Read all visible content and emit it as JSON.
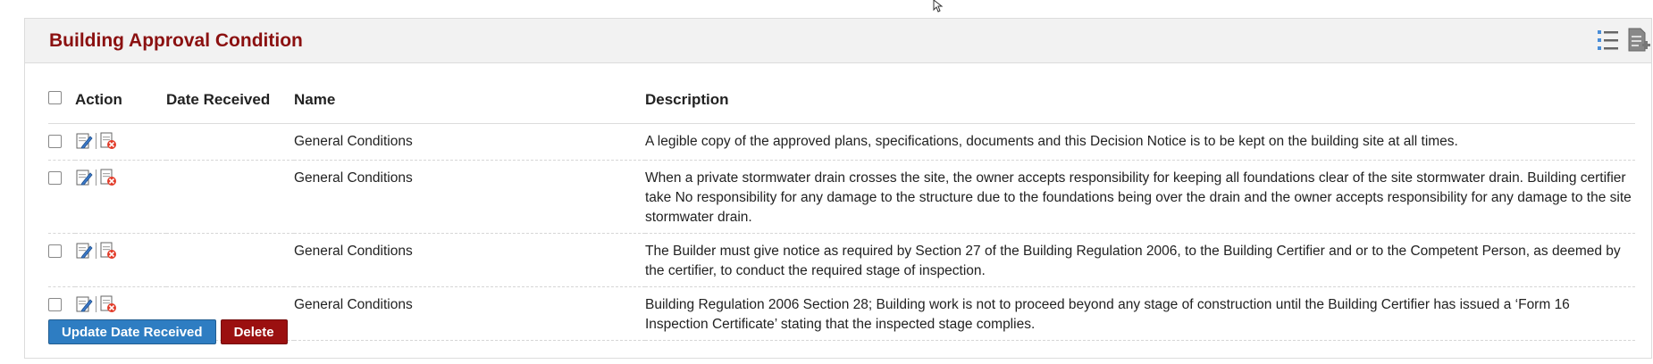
{
  "panel": {
    "title": "Building Approval Condition"
  },
  "table": {
    "headers": {
      "action": "Action",
      "date_received": "Date Received",
      "name": "Name",
      "description": "Description"
    },
    "rows": [
      {
        "date_received": "",
        "name": "General Conditions",
        "description": "A legible copy of the approved plans, specifications, documents and this Decision Notice is to be kept on the building site at all times."
      },
      {
        "date_received": "",
        "name": "General Conditions",
        "description": "When a private stormwater drain crosses the site, the owner accepts responsibility for keeping all foundations clear of the site stormwater drain. Building certifier take No responsibility for any damage to the structure due to the foundations being over the drain and the owner accepts responsibility for any damage to the site stormwater drain."
      },
      {
        "date_received": "",
        "name": "General Conditions",
        "description": "The Builder must give notice as required by Section 27 of the Building Regulation 2006, to the Building Certifier and or to the Competent Person, as deemed by the certifier, to conduct the required stage of inspection."
      },
      {
        "date_received": "",
        "name": "General Conditions",
        "description": "Building Regulation 2006 Section 28; Building work is not to proceed beyond any stage of construction until the Building Certifier has issued a ‘Form 16 Inspection Certificate’ stating that the inspected stage complies."
      }
    ]
  },
  "buttons": {
    "update_label": "Update Date Received",
    "delete_label": "Delete"
  },
  "colors": {
    "title": "#8b1010",
    "update_button": "#2e7dc2",
    "delete_button": "#9b1010"
  },
  "icons": {
    "header": [
      "list-icon",
      "add-document-icon"
    ],
    "row": [
      "edit-icon",
      "delete-icon"
    ],
    "cursor": "mouse-pointer-icon"
  }
}
